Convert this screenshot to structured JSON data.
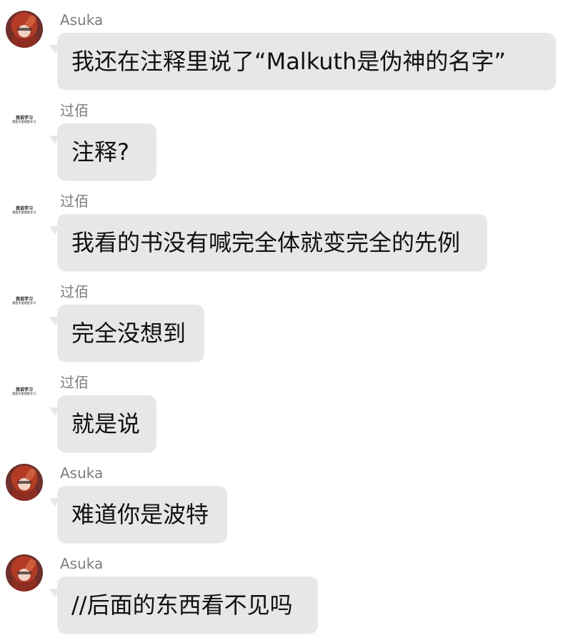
{
  "messages": [
    {
      "sender": "Asuka",
      "text": "我还在注释里说了“Malkuth是伪神的名字”",
      "avatar": "asuka-avatar-icon"
    },
    {
      "sender": "过佰",
      "text": "注释?",
      "avatar": "text-avatar",
      "avatar_text": [
        "我说学习",
        "我是学習就是学习"
      ]
    },
    {
      "sender": "过佰",
      "text": "我看的书没有喊完全体就变完全的先例",
      "avatar": "text-avatar",
      "avatar_text": [
        "我说学习",
        "我是学習就是学习"
      ]
    },
    {
      "sender": "过佰",
      "text": "完全没想到",
      "avatar": "text-avatar",
      "avatar_text": [
        "我说学习",
        "我是学習就是学习"
      ]
    },
    {
      "sender": "过佰",
      "text": "就是说",
      "avatar": "text-avatar",
      "avatar_text": [
        "我说学习",
        "我是学習就是学习"
      ]
    },
    {
      "sender": "Asuka",
      "text": "难道你是波特",
      "avatar": "asuka-avatar-icon"
    },
    {
      "sender": "Asuka",
      "text": "//后面的东西看不见吗",
      "avatar": "asuka-avatar-icon"
    }
  ],
  "colors": {
    "background": "#ffffff",
    "bubble": "#e7e7e7",
    "name": "#7c7c7c",
    "text": "#111111"
  }
}
